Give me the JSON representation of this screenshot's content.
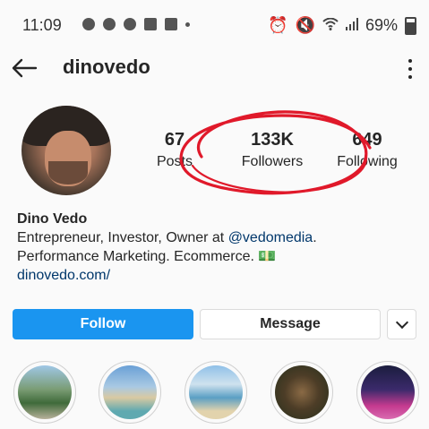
{
  "status_bar": {
    "time": "11:09",
    "battery": "69%"
  },
  "header": {
    "username": "dinovedo"
  },
  "stats": [
    {
      "value": "67",
      "label": "Posts"
    },
    {
      "value": "133K",
      "label": "Followers"
    },
    {
      "value": "649",
      "label": "Following"
    }
  ],
  "bio": {
    "name": "Dino Vedo",
    "line1_prefix": "Entrepreneur, Investor, Owner at ",
    "mention": "@vedomedia",
    "line1_suffix": ".",
    "line2": "Performance Marketing. Ecommerce. 💵",
    "website": "dinovedo.com/"
  },
  "actions": {
    "follow": "Follow",
    "message": "Message"
  },
  "highlights": [
    {
      "icon": "resort-highlight"
    },
    {
      "icon": "beach-highlight"
    },
    {
      "icon": "pool-highlight"
    },
    {
      "icon": "dinner-highlight"
    },
    {
      "icon": "night-highlight"
    }
  ],
  "colors": {
    "follow_button": "#1a95f0",
    "link": "#00376b",
    "annotation": "#e0192a"
  }
}
